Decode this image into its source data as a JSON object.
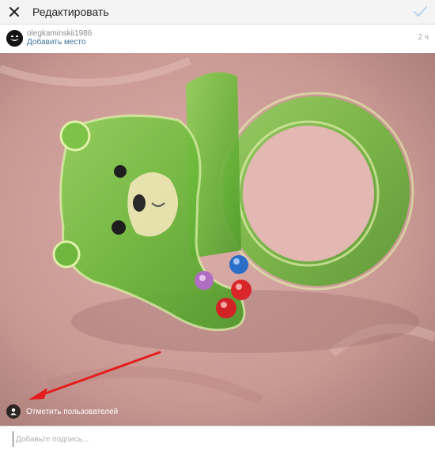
{
  "topbar": {
    "title": "Редактировать",
    "close_icon": "close-icon",
    "confirm_icon": "checkmark-icon",
    "confirm_color": "#b8d4ec"
  },
  "post": {
    "username": "olegkaminskii1986",
    "add_location": "Добавить место",
    "time": "2 ч",
    "location_color": "#3f729b"
  },
  "photo": {
    "tag_users_label": "Отметить пользователей",
    "tag_icon": "user-icon"
  },
  "caption": {
    "placeholder": "Добавьте подпись..."
  }
}
